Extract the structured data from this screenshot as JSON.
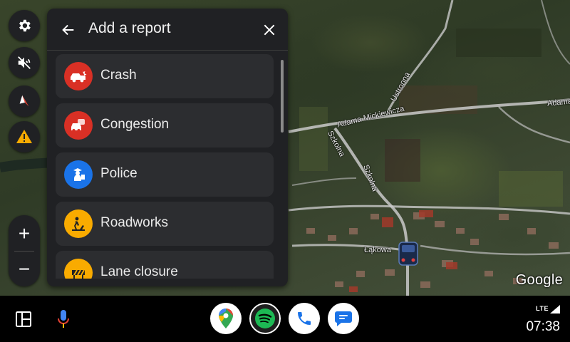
{
  "map": {
    "street_labels": [
      "Adama Mickiewicza",
      "Adama",
      "Szkolna",
      "Szkolna",
      "Ustronna",
      "Łąkowa"
    ],
    "attribution": "Google"
  },
  "left_rail": {
    "buttons": [
      {
        "name": "settings",
        "icon": "gear-icon"
      },
      {
        "name": "mute",
        "icon": "volume-off-icon"
      },
      {
        "name": "compass",
        "icon": "compass-icon"
      },
      {
        "name": "report",
        "icon": "warning-icon",
        "color": "#f9ab00"
      }
    ],
    "zoom_in": "+",
    "zoom_out": "−"
  },
  "report_panel": {
    "title": "Add a report",
    "back_icon": "arrow-back-icon",
    "close_icon": "close-icon",
    "items": [
      {
        "label": "Crash",
        "icon": "crash-icon",
        "color": "#d93025"
      },
      {
        "label": "Congestion",
        "icon": "congestion-icon",
        "color": "#d93025"
      },
      {
        "label": "Police",
        "icon": "police-icon",
        "color": "#1a73e8"
      },
      {
        "label": "Roadworks",
        "icon": "roadworks-icon",
        "color": "#f9ab00"
      },
      {
        "label": "Lane closure",
        "icon": "lane-closure-icon",
        "color": "#f9ab00"
      }
    ]
  },
  "taskbar": {
    "apps": [
      {
        "name": "Google Maps",
        "icon": "maps-icon"
      },
      {
        "name": "Spotify",
        "icon": "spotify-icon"
      },
      {
        "name": "Phone",
        "icon": "phone-icon"
      },
      {
        "name": "Messages",
        "icon": "messages-icon"
      }
    ],
    "network": "LTE",
    "time": "07:38"
  }
}
